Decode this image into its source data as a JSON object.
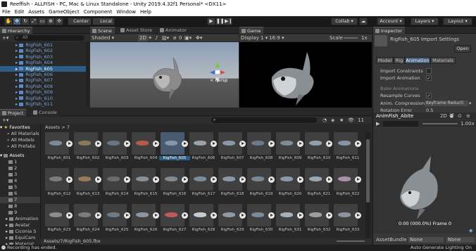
{
  "window": {
    "title": "Reeffish - ALLFISH - PC, Mac & Linux Standalone - Unity 2019.4.32f1 Personal* <DX11>"
  },
  "menu": [
    "File",
    "Edit",
    "Assets",
    "GameObject",
    "Component",
    "Window",
    "Help"
  ],
  "toolbar": {
    "pivot_label": "Center",
    "space_label": "Local",
    "collab_label": "Collab ▾",
    "account_label": "Account",
    "layers_label": "Layers",
    "layout_label": "Layout"
  },
  "hierarchy": {
    "tab_label": "Hierarchy",
    "add_label": "+▾",
    "search_placeholder": "All",
    "items": [
      "RigFish_601",
      "RigFish_602",
      "RigFish_603",
      "RigFish_604",
      "RigFish_605",
      "RigFish_606",
      "RigFish_607",
      "RigFish_608",
      "RigFish_609",
      "RigFish_610",
      "RigFish_611"
    ],
    "selected_index": 4
  },
  "scene": {
    "tabs": [
      "Scene",
      "Asset Store",
      "Animator"
    ],
    "shading": "Shaded",
    "mode_2d": "2D",
    "gizmo_count": "0",
    "persp_label": "< Persp"
  },
  "game": {
    "tab_label": "Game",
    "display": "Display 1",
    "aspect": "16:9",
    "scale_label": "Scale",
    "scale_value": "1x"
  },
  "inspector": {
    "tab_label": "Inspector",
    "title": "RigFish_605 Import Settings",
    "open_button": "Open",
    "tabs": [
      "Model",
      "Rig",
      "Animation",
      "Materials"
    ],
    "active_tab": "Animation",
    "rows": [
      {
        "label": "Import Constraints",
        "checked": false
      },
      {
        "label": "Import Animation",
        "checked": true
      }
    ],
    "bake_label": "Bake Animations",
    "resample_label": "Resample Curves",
    "resample_checked": true,
    "compression_label": "Anim. Compression",
    "compression_value": "Keyframe Reducti",
    "rotation_error_label": "Rotation Error",
    "rotation_error_value": "0.5",
    "anim_name": "AnimFish_Abite",
    "anim_2d": "2D",
    "speed": "1.00x",
    "time_readout": "0:00 (000.0%) Frame 0",
    "assetbundle_label": "AssetBundle",
    "assetbundle_value": "None",
    "assetbundle_variant": "None"
  },
  "project": {
    "tabs": [
      "Project",
      "Console"
    ],
    "favorites_label": "Favorites",
    "favorites": [
      "All Materials",
      "All Models",
      "All Prefabs"
    ],
    "assets_label": "Assets",
    "folders": [
      "1",
      "2",
      "3",
      "4",
      "5",
      "6",
      "7",
      "8",
      "9",
      "Animation",
      "Avatar",
      "Ciconia S",
      "EquiCam",
      "Material"
    ],
    "breadcrumb": "Assets > 7",
    "count": "11",
    "assets": [
      "RigFish_601",
      "RigFish_602",
      "RigFish_603",
      "RigFish_604",
      "RigFish_605",
      "RigFish_606",
      "RigFish_607",
      "RigFish_608",
      "RigFish_609",
      "RigFish_610",
      "RigFish_611",
      "RigFish_612",
      "RigFish_613",
      "RigFish_614",
      "RigFish_615",
      "RigFish_616",
      "RigFish_617",
      "RigFish_618",
      "RigFish_619",
      "RigFish_620",
      "RigFish_621",
      "RigFish_622",
      "RigFish_623",
      "RigFish_624",
      "RigFish_625",
      "RigFish_626",
      "RigFish_627",
      "RigFish_628",
      "RigFish_629",
      "RigFish_630",
      "RigFish_631",
      "RigFish_632",
      "RigFish_633"
    ],
    "selected_asset_index": 4,
    "selected_path": "Assets/7/RigFish_605.fbx"
  },
  "status": {
    "message": "Recording has ended.",
    "right": "Auto Generate Lighting On"
  },
  "colors": {
    "selection": "#2c5d87",
    "hierarchy_text": "#7aa6d8",
    "panel": "#282828"
  }
}
